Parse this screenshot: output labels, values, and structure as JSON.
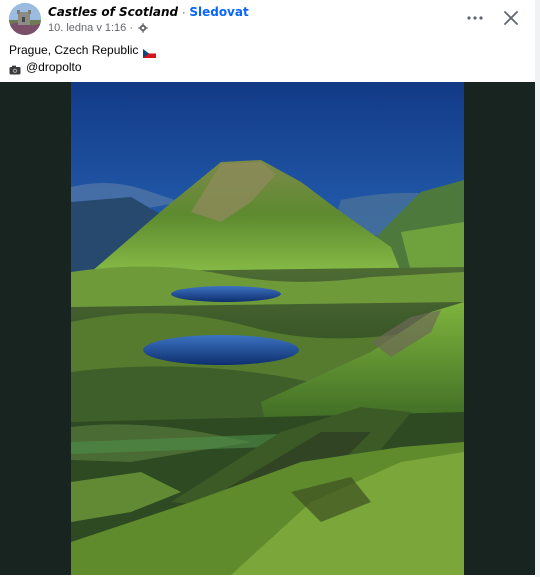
{
  "post": {
    "author": "Castles of Scotland",
    "separator": "·",
    "follow_label": "Sledovat",
    "timestamp": "10. ledna v 1:16",
    "meta_separator": "·",
    "audience_icon": "settings-icon",
    "actions": {
      "more_icon": "more-dots-icon",
      "close_icon": "close-icon"
    }
  },
  "caption": {
    "location": "Prague, Czech Republic",
    "location_flag": "czech-flag-icon",
    "credit": "@dropolto",
    "credit_icon": "camera-icon"
  },
  "media": {
    "type": "photo",
    "subject": "mountain landscape with lakes"
  },
  "colors": {
    "link": "#0866ff",
    "media_background": "#18241f",
    "text_primary": "#050505",
    "text_secondary": "#65676b"
  }
}
